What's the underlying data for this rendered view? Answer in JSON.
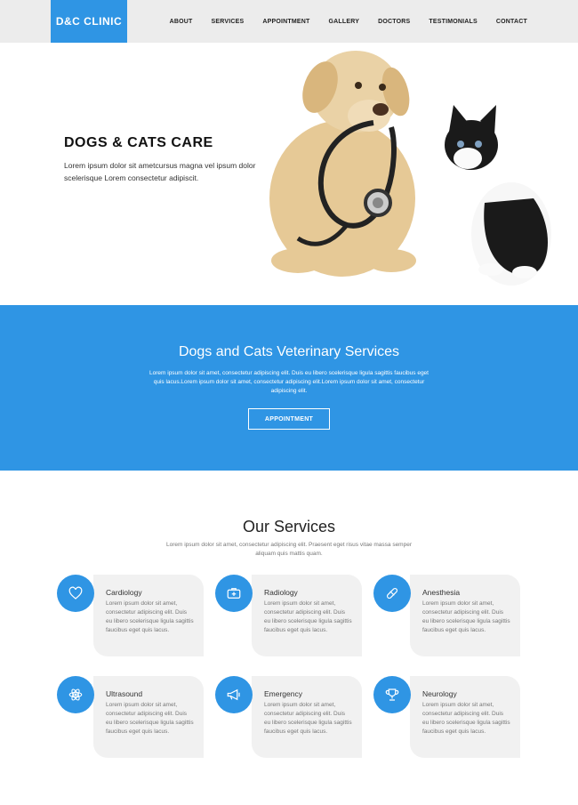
{
  "header": {
    "logo": "D&C CLINIC",
    "nav": [
      "ABOUT",
      "SERVICES",
      "APPOINTMENT",
      "GALLERY",
      "DOCTORS",
      "TESTIMONIALS",
      "CONTACT"
    ]
  },
  "hero": {
    "title": "DOGS & CATS CARE",
    "text": "Lorem ipsum dolor sit ametcursus magna vel ipsum dolor scelerisque Lorem consectetur adipiscit."
  },
  "band": {
    "title": "Dogs and Cats Veterinary Services",
    "text": "Lorem ipsum dolor sit amet, consectetur adipiscing elit. Duis eu libero scelerisque ligula sagittis faucibus eget quis lacus.Lorem ipsum dolor sit amet, consectetur adipiscing elit.Lorem ipsum dolor sit amet, consectetur adipiscing elit.",
    "button": "APPOINTMENT"
  },
  "services": {
    "title": "Our Services",
    "subtitle": "Lorem ipsum dolor sit amet, consectetur adipiscing elit. Praesent eget risus vitae massa semper aliquam quis mattis quam.",
    "items": [
      {
        "title": "Cardiology",
        "text": "Lorem ipsum dolor sit amet, consectetur adipiscing elit. Duis eu libero scelerisque ligula sagittis faucibus eget quis lacus.",
        "icon": "heart-icon"
      },
      {
        "title": "Radiology",
        "text": "Lorem ipsum dolor sit amet, consectetur adipiscing elit. Duis eu libero scelerisque ligula sagittis faucibus eget quis lacus.",
        "icon": "medkit-icon"
      },
      {
        "title": "Anesthesia",
        "text": "Lorem ipsum dolor sit amet, consectetur adipiscing elit. Duis eu libero scelerisque ligula sagittis faucibus eget quis lacus.",
        "icon": "pills-icon"
      },
      {
        "title": "Ultrasound",
        "text": "Lorem ipsum dolor sit amet, consectetur adipiscing elit. Duis eu libero scelerisque ligula sagittis faucibus eget quis lacus.",
        "icon": "atom-icon"
      },
      {
        "title": "Emergency",
        "text": "Lorem ipsum dolor sit amet, consectetur adipiscing elit. Duis eu libero scelerisque ligula sagittis faucibus eget quis lacus.",
        "icon": "megaphone-icon"
      },
      {
        "title": "Neurology",
        "text": "Lorem ipsum dolor sit amet, consectetur adipiscing elit. Duis eu libero scelerisque ligula sagittis faucibus eget quis lacus.",
        "icon": "trophy-icon"
      }
    ]
  },
  "colors": {
    "accent": "#2f95e4",
    "card_bg": "#f1f1f1",
    "header_bg": "#ececec"
  }
}
